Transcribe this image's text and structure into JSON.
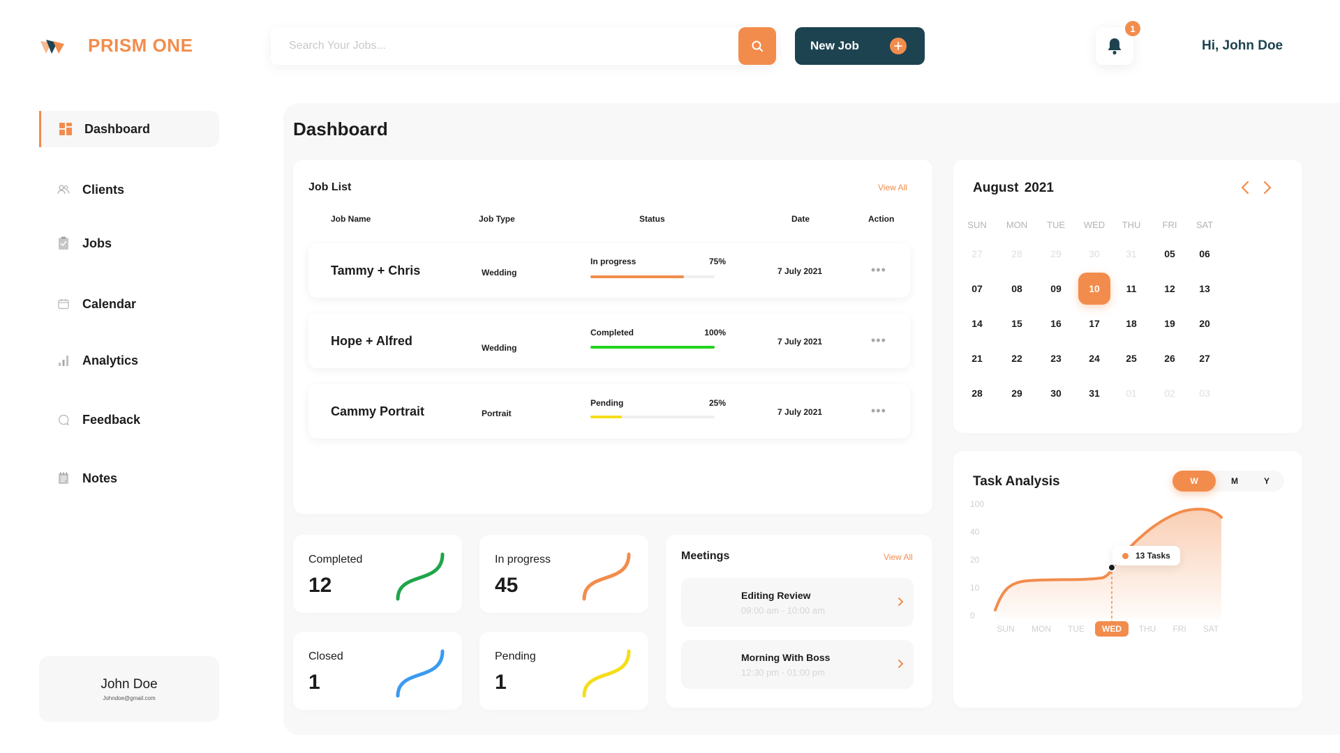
{
  "brand": {
    "name": "PRISM ONE"
  },
  "header": {
    "search_placeholder": "Search Your Jobs...",
    "new_job_label": "New Job",
    "notification_count": "1",
    "greeting": "Hi, John Doe"
  },
  "sidebar": {
    "items": [
      {
        "label": "Dashboard",
        "icon": "dashboard-icon",
        "active": true
      },
      {
        "label": "Clients",
        "icon": "users-icon"
      },
      {
        "label": "Jobs",
        "icon": "clipboard-icon"
      },
      {
        "label": "Calendar",
        "icon": "calendar-icon"
      },
      {
        "label": "Analytics",
        "icon": "bar-chart-icon"
      },
      {
        "label": "Feedback",
        "icon": "chat-bubble-icon"
      },
      {
        "label": "Notes",
        "icon": "notes-icon"
      }
    ],
    "user": {
      "name": "John Doe",
      "email": "Johndoe@gmail.com"
    }
  },
  "main": {
    "title": "Dashboard",
    "job_list": {
      "title": "Job List",
      "view_all": "View All",
      "columns": [
        "Job Name",
        "Job Type",
        "Status",
        "Date",
        "Action"
      ],
      "rows": [
        {
          "name": "Tammy + Chris",
          "type": "Wedding",
          "status": "In progress",
          "percent_label": "75%",
          "progress": 0.75,
          "bar_color": "#f28c4c",
          "date": "7 July 2021"
        },
        {
          "name": "Hope + Alfred",
          "type": "Wedding",
          "status": "Completed",
          "percent_label": "100%",
          "progress": 1.0,
          "bar_color": "#22d31f",
          "date": "7 July 2021"
        },
        {
          "name": "Cammy Portrait",
          "type": "Portrait",
          "status": "Pending",
          "percent_label": "25%",
          "progress": 0.25,
          "bar_color": "#f5dd19",
          "date": "7 July 2021"
        }
      ]
    },
    "stats": [
      {
        "label": "Completed",
        "value": "12",
        "color": "#1fa54a"
      },
      {
        "label": "In progress",
        "value": "45",
        "color": "#f28c4c"
      },
      {
        "label": "Closed",
        "value": "1",
        "color": "#3b9af0"
      },
      {
        "label": "Pending",
        "value": "1",
        "color": "#f5dd19"
      }
    ],
    "meetings": {
      "title": "Meetings",
      "view_all": "View All",
      "items": [
        {
          "title": "Editing Review",
          "time": "09:00 am - 10:00 am"
        },
        {
          "title": "Morning With Boss",
          "time": "12:30 pm - 01:00 pm"
        }
      ]
    },
    "calendar": {
      "month": "August",
      "year": "2021",
      "weekdays": [
        "SUN",
        "MON",
        "TUE",
        "WED",
        "THU",
        "FRI",
        "SAT"
      ],
      "weeks": [
        [
          {
            "d": "27",
            "m": true
          },
          {
            "d": "28",
            "m": true
          },
          {
            "d": "29",
            "m": true
          },
          {
            "d": "30",
            "m": true
          },
          {
            "d": "31",
            "m": true
          },
          {
            "d": "05"
          },
          {
            "d": "06"
          }
        ],
        [
          {
            "d": "07"
          },
          {
            "d": "08"
          },
          {
            "d": "09"
          },
          {
            "d": "10",
            "sel": true
          },
          {
            "d": "11"
          },
          {
            "d": "12"
          },
          {
            "d": "13"
          }
        ],
        [
          {
            "d": "14"
          },
          {
            "d": "15"
          },
          {
            "d": "16"
          },
          {
            "d": "17"
          },
          {
            "d": "18"
          },
          {
            "d": "19"
          },
          {
            "d": "20"
          }
        ],
        [
          {
            "d": "21"
          },
          {
            "d": "22"
          },
          {
            "d": "23"
          },
          {
            "d": "24"
          },
          {
            "d": "25"
          },
          {
            "d": "26"
          },
          {
            "d": "27"
          }
        ],
        [
          {
            "d": "28"
          },
          {
            "d": "29"
          },
          {
            "d": "30"
          },
          {
            "d": "31"
          },
          {
            "d": "01",
            "m": true
          },
          {
            "d": "02",
            "m": true
          },
          {
            "d": "03",
            "m": true
          }
        ]
      ]
    },
    "task_analysis": {
      "title": "Task Analysis",
      "periods": [
        "W",
        "M",
        "Y"
      ],
      "active_period": "W",
      "tooltip": "13 Tasks",
      "accent": "#f28c4c"
    }
  },
  "chart_data": {
    "type": "area",
    "title": "Task Analysis",
    "categories": [
      "SUN",
      "MON",
      "TUE",
      "WED",
      "THU",
      "FRI",
      "SAT"
    ],
    "y_ticks": [
      "100",
      "40",
      "20",
      "10",
      "0"
    ],
    "values": [
      0,
      12,
      13,
      20,
      40,
      90,
      95
    ],
    "highlight_category": "WED",
    "highlight_label": "13 Tasks"
  }
}
